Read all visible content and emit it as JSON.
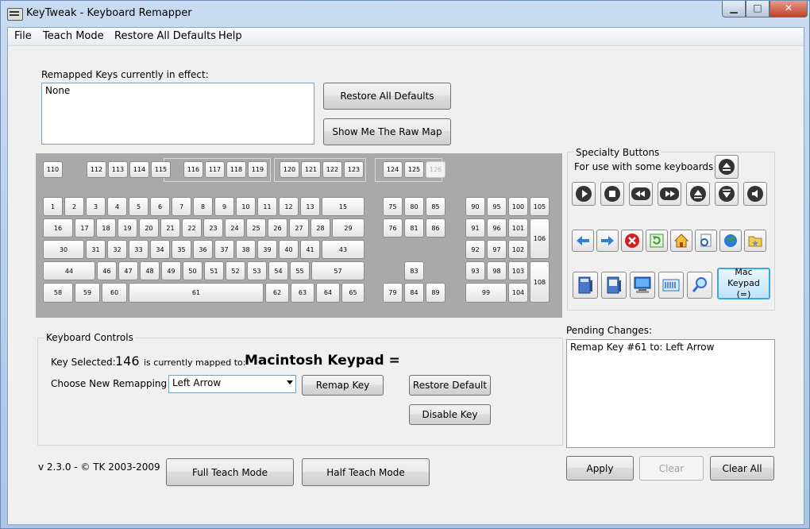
{
  "window": {
    "title": "KeyTweak -  Keyboard Remapper",
    "min": "▁",
    "max": "□",
    "close": "✕"
  },
  "menu": [
    "File",
    "Teach Mode",
    "Restore All Defaults",
    "Help"
  ],
  "remapped": {
    "label": "Remapped Keys currently in effect:",
    "value": "None"
  },
  "buttons": {
    "restore_all": "Restore All Defaults",
    "raw_map": "Show Me The Raw Map",
    "remap_key": "Remap Key",
    "restore_default": "Restore Default",
    "disable_key": "Disable Key",
    "full_teach": "Full Teach Mode",
    "half_teach": "Half Teach Mode",
    "apply": "Apply",
    "clear": "Clear",
    "clear_all": "Clear All"
  },
  "keys": {
    "r1": [
      "110",
      "112",
      "113",
      "114",
      "115",
      "116",
      "117",
      "118",
      "119",
      "120",
      "121",
      "122",
      "123",
      "124",
      "125",
      "126"
    ],
    "r2": [
      "1",
      "2",
      "3",
      "4",
      "5",
      "6",
      "7",
      "8",
      "9",
      "10",
      "11",
      "12",
      "13",
      "15"
    ],
    "r3": [
      "16",
      "17",
      "18",
      "19",
      "20",
      "21",
      "22",
      "23",
      "24",
      "25",
      "26",
      "27",
      "28",
      "29"
    ],
    "r4": [
      "30",
      "31",
      "32",
      "33",
      "34",
      "35",
      "36",
      "37",
      "38",
      "39",
      "40",
      "41",
      "43"
    ],
    "r5": [
      "44",
      "46",
      "47",
      "48",
      "49",
      "50",
      "51",
      "52",
      "53",
      "54",
      "55",
      "57"
    ],
    "r6": [
      "58",
      "59",
      "60",
      "61",
      "62",
      "63",
      "64",
      "65"
    ],
    "nav": [
      "75",
      "80",
      "85",
      "76",
      "81",
      "86",
      "83",
      "79",
      "84",
      "89"
    ],
    "num": [
      "90",
      "95",
      "100",
      "105",
      "91",
      "96",
      "101",
      "106",
      "92",
      "97",
      "102",
      "93",
      "98",
      "103",
      "108",
      "99",
      "104"
    ]
  },
  "specialty": {
    "title": "Specialty Buttons",
    "subtitle": "For use with some keyboards",
    "mac_label": "Mac Keypad (=)"
  },
  "controls": {
    "title": "Keyboard Controls",
    "key_selected_label": "Key Selected:",
    "key_selected_value": "146",
    "mapped_label": "is currently mapped to:",
    "mapped_value": "Macintosh Keypad =",
    "choose_label": "Choose New Remapping",
    "choose_value": "Left Arrow"
  },
  "pending": {
    "label": "Pending Changes:",
    "value": "Remap Key #61 to: Left Arrow"
  },
  "version": "v 2.3.0 - © TK 2003-2009"
}
